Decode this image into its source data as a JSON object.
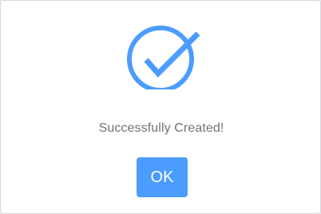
{
  "dialog": {
    "icon": "check-circle-icon",
    "message": "Successfully Created!",
    "ok_label": "OK"
  },
  "colors": {
    "accent": "#4c9cfe",
    "text": "#717478",
    "background": "#ffffff"
  }
}
